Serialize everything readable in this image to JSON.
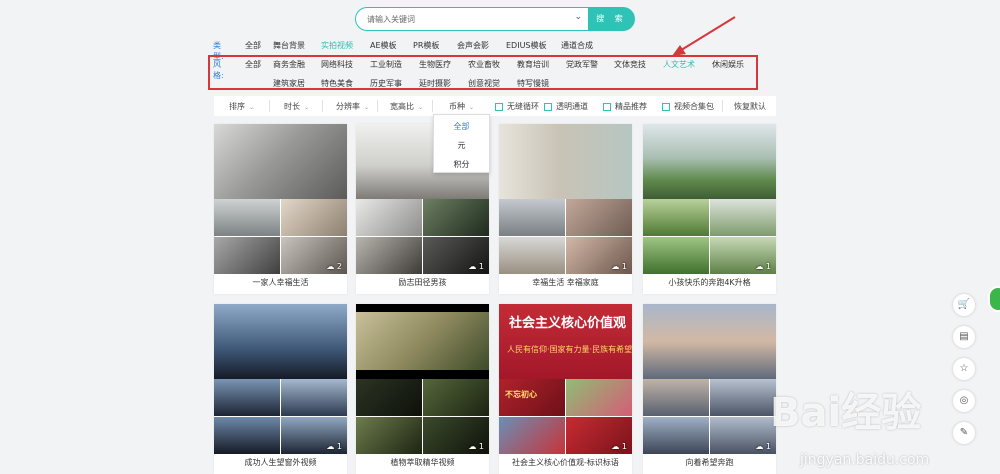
{
  "search": {
    "placeholder": "请输入关键词",
    "button": "搜 索"
  },
  "type_filter": {
    "label": "类型:",
    "items": [
      "全部",
      "舞台背景",
      "实拍视频",
      "AE模板",
      "PR模板",
      "会声会影",
      "EDIUS模板",
      "通道合成"
    ],
    "active": "实拍视频"
  },
  "style_filter": {
    "label": "风格:",
    "row1": [
      "全部",
      "商务金融",
      "网络科技",
      "工业制造",
      "生物医疗",
      "农业畜牧",
      "教育培训",
      "党政军警",
      "文体竞技",
      "人文艺术",
      "休闲娱乐"
    ],
    "row2": [
      "建筑家居",
      "特色美食",
      "历史军事",
      "延时摄影",
      "创意视觉",
      "特写慢镜"
    ],
    "highlighted": "人文艺术",
    "highlight_box_color": "#d7363b"
  },
  "sortbar": {
    "sorts": [
      "排序",
      "时长",
      "分辨率",
      "宽高比",
      "币种"
    ],
    "checks": [
      "无缝循环",
      "透明通道",
      "精品推荐",
      "视频合集包"
    ],
    "reset": "恢复默认"
  },
  "currency_dropdown": {
    "options": [
      "全部",
      "元",
      "积分"
    ],
    "selected": "全部"
  },
  "cards": [
    {
      "title": "一家人幸福生活",
      "count": "2"
    },
    {
      "title": "励志田径男孩",
      "count": "1"
    },
    {
      "title": "幸福生活 幸福家庭",
      "count": "1"
    },
    {
      "title": "小孩快乐的奔跑4K升格",
      "count": "1"
    },
    {
      "title": "成功人生望窗外视频",
      "count": "1"
    },
    {
      "title": "植物萃取精华视频",
      "count": "1"
    },
    {
      "title": "社会主义核心价值观-标识标语",
      "count": "1"
    },
    {
      "title": "向着希望奔跑",
      "count": "1"
    }
  ],
  "poster_text": {
    "line1": "社会主义核心价值观",
    "line2": "人民有信仰·国家有力量·民族有希望",
    "line3": "不忘初心"
  },
  "sidebar": {
    "icons": [
      "cart-icon",
      "clipboard-icon",
      "star-icon",
      "headset-icon",
      "edit-icon"
    ],
    "cart_badge": "0"
  },
  "watermark": {
    "brand": "Bai经验",
    "url": "jingyan.baidu.com"
  },
  "colors": {
    "accent": "#2fc3b8",
    "link": "#2d7fd3",
    "annotation": "#d7363b"
  }
}
